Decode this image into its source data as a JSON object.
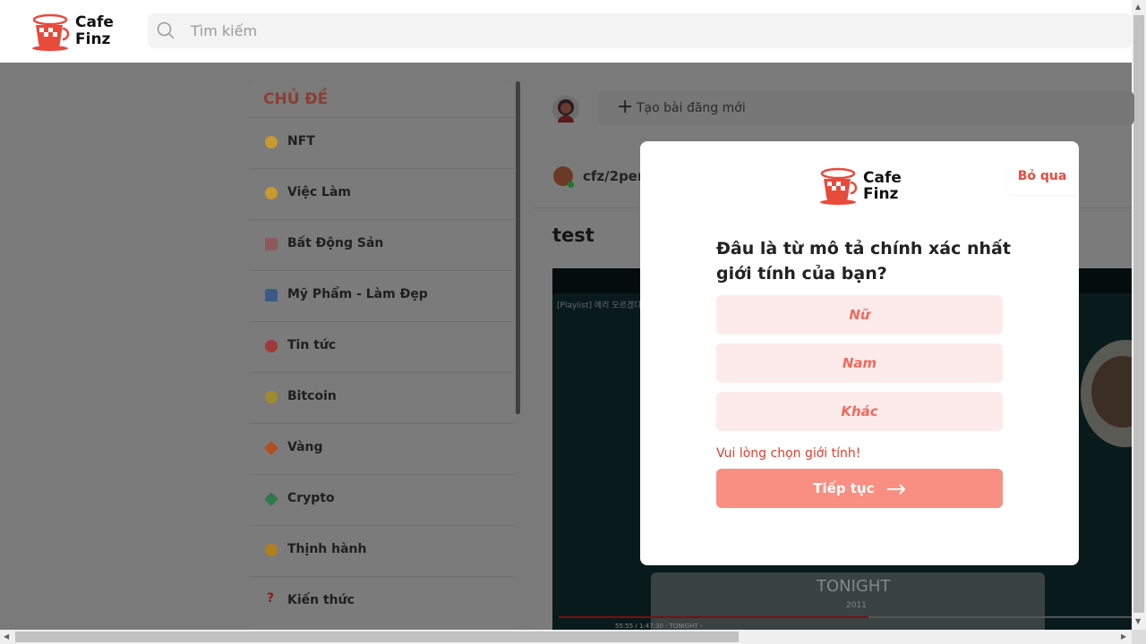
{
  "header": {
    "logo_line1": "Cafe",
    "logo_line2": "Finz",
    "search_placeholder": "Tìm kiếm"
  },
  "sidebar": {
    "title": "CHỦ ĐỀ",
    "items": [
      {
        "label": "NFT",
        "icon": "grinning-face-icon",
        "color": "#c79a2e"
      },
      {
        "label": "Việc Làm",
        "icon": "tongue-face-icon",
        "color": "#c79a2e"
      },
      {
        "label": "Bất Động Sản",
        "icon": "buildings-icon",
        "color": "#8c5a5a"
      },
      {
        "label": "Mỹ Phẩm - Làm Đẹp",
        "icon": "dress-icon",
        "color": "#3a5a8a"
      },
      {
        "label": "Tin tức",
        "icon": "no-entry-icon",
        "color": "#a03a3a"
      },
      {
        "label": "Bitcoin",
        "icon": "money-face-icon",
        "color": "#a08a2e"
      },
      {
        "label": "Vàng",
        "icon": "diamond-icon",
        "color": "#b0501e"
      },
      {
        "label": "Crypto",
        "icon": "dollar-bills-icon",
        "color": "#2e7a4a"
      },
      {
        "label": "Thịnh hành",
        "icon": "hugging-face-icon",
        "color": "#b0801e"
      },
      {
        "label": "Kiến thức",
        "icon": "question-mark-icon",
        "color": "#b02020"
      }
    ]
  },
  "feed": {
    "new_post_label": "Tạo bài đăng mới",
    "post": {
      "author": "cfz/2per",
      "title": "test",
      "video_label": "[Playlist] 에리 모르겠다",
      "video_caption": "TONIGHT",
      "video_year": "2011",
      "video_time": "55:55 / 1:47:30 · TONIGHT ›",
      "progress": 0.54
    }
  },
  "modal": {
    "logo_line1": "Cafe",
    "logo_line2": "Finz",
    "skip_label": "Bỏ qua",
    "question": "Đâu là từ mô tả chính xác nhất giới tính của bạn?",
    "options": [
      "Nữ",
      "Nam",
      "Khác"
    ],
    "error": "Vui lòng chọn giới tính!",
    "continue_label": "Tiếp tục"
  },
  "colors": {
    "accent": "#ef6a5e",
    "accent_light": "#fdebeb",
    "button": "#f98e83",
    "error": "#e23c2d"
  }
}
